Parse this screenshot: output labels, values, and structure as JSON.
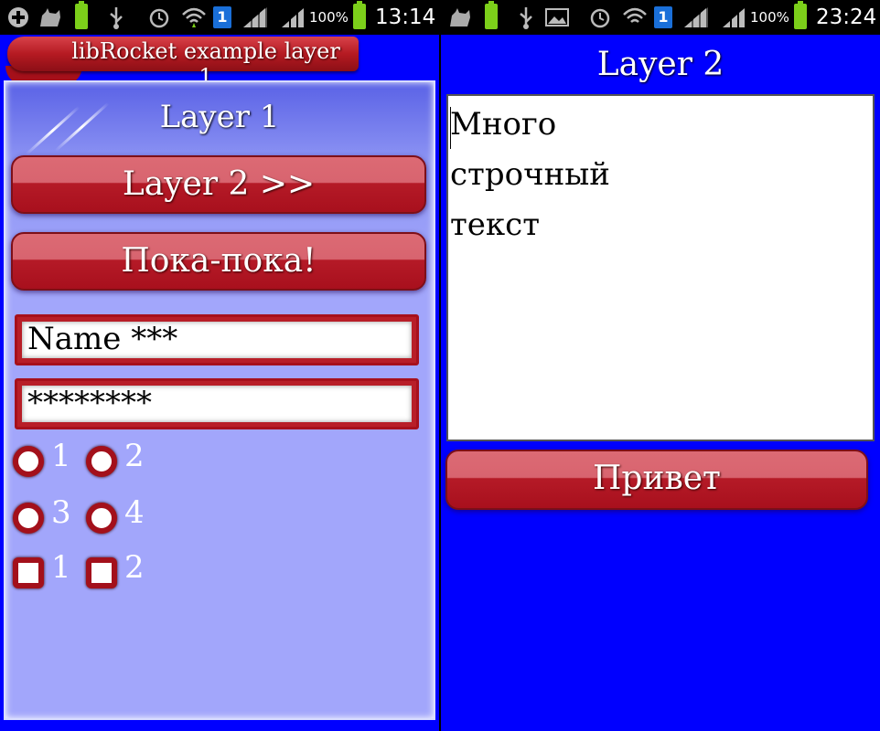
{
  "left": {
    "status": {
      "battery_pct": "100%",
      "time": "13:14"
    },
    "header_tab": "libRocket example layer 1",
    "panel_title": "Layer 1",
    "buttons": {
      "layer2": "Layer 2 >>",
      "bye": "Пока-пока!"
    },
    "fields": {
      "name_value": "Name ***",
      "password_value": "********"
    },
    "radios": [
      {
        "label": "1"
      },
      {
        "label": "2"
      },
      {
        "label": "3"
      },
      {
        "label": "4"
      }
    ],
    "checkboxes": [
      {
        "label": "1"
      },
      {
        "label": "2"
      }
    ]
  },
  "right": {
    "status": {
      "battery_pct": "100%",
      "time": "23:24"
    },
    "title": "Layer 2",
    "textarea_lines": [
      "Много",
      "строчный",
      "текст"
    ],
    "button": "Привет"
  },
  "colors": {
    "background": "#0000ff",
    "button_red": "#b51a27",
    "panel": "#a2a6fb"
  },
  "icons": {
    "left_status": [
      "add-icon",
      "cat-icon",
      "battery-small-icon",
      "usb-icon",
      "alarm-icon",
      "wifi-icon",
      "sim-icon",
      "signal-icon",
      "signal-icon"
    ],
    "right_status": [
      "cat-icon",
      "battery-small-icon",
      "usb-icon",
      "image-icon",
      "alarm-icon",
      "wifi-icon",
      "sim-icon",
      "signal-icon",
      "signal-icon"
    ]
  }
}
